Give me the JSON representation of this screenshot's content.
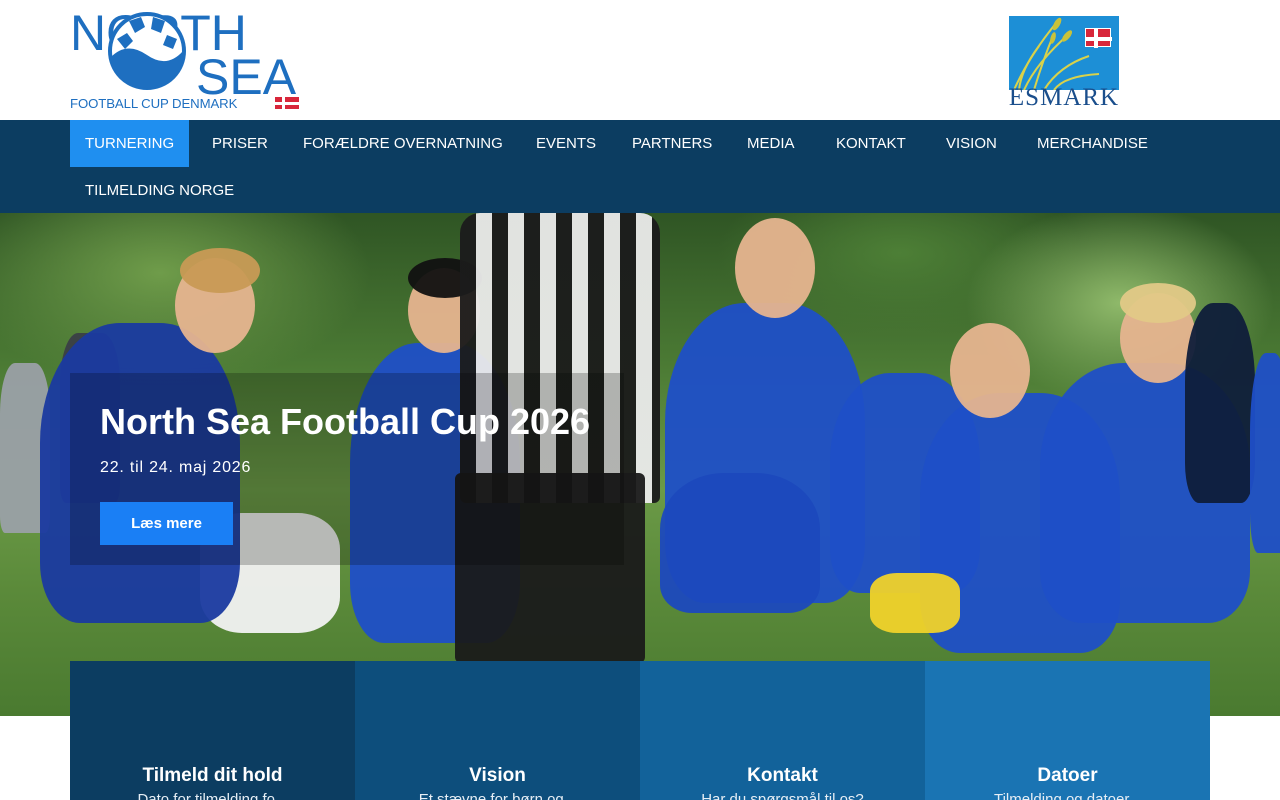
{
  "header": {
    "logo": {
      "word1": "NORTH",
      "word2": "SEA",
      "subtitle": "FOOTBALL CUP DENMARK"
    },
    "partner_logo": {
      "text": "ESMARK"
    }
  },
  "nav": {
    "items": [
      {
        "label": "TURNERING",
        "active": true
      },
      {
        "label": "PRISER"
      },
      {
        "label": "FORÆLDRE OVERNATNING"
      },
      {
        "label": "EVENTS"
      },
      {
        "label": "PARTNERS"
      },
      {
        "label": "MEDIA"
      },
      {
        "label": "KONTAKT"
      },
      {
        "label": "VISION"
      },
      {
        "label": "MERCHANDISE"
      },
      {
        "label": "TILMELDING NORGE"
      }
    ]
  },
  "hero": {
    "title": "North Sea Football Cup 2026",
    "date": "22. til 24. maj 2026",
    "button": "Læs mere"
  },
  "boxes": [
    {
      "title": "Tilmeld dit hold",
      "text": "Dato for tilmelding fo...",
      "color": "#0c3d61"
    },
    {
      "title": "Vision",
      "text": "Et stævne for børn og...",
      "color": "#0d4e7c"
    },
    {
      "title": "Kontakt",
      "text": "Har du spørgsmål til os?",
      "color": "#12629a"
    },
    {
      "title": "Datoer",
      "text": "Tilmelding og datoer...",
      "color": "#1a74b3"
    }
  ],
  "colors": {
    "nav_bg": "#0c3d61",
    "accent": "#1f8ff0",
    "logo_blue": "#1e6fc0"
  }
}
